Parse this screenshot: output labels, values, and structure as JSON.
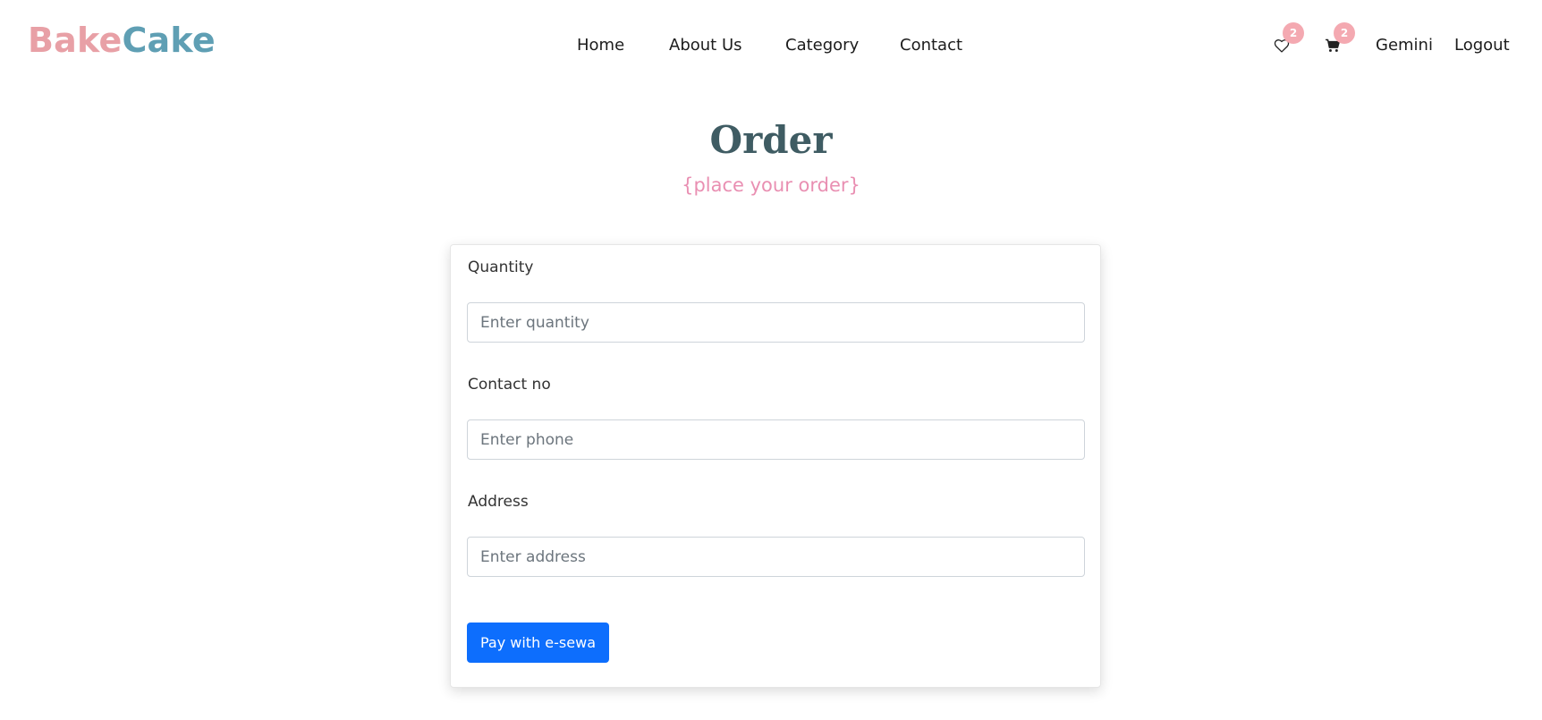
{
  "brand": {
    "part1": "Bake",
    "part2": "Cake"
  },
  "nav": {
    "links": [
      "Home",
      "About Us",
      "Category",
      "Contact"
    ],
    "wishlist_count": "2",
    "cart_count": "2",
    "user": "Gemini",
    "logout": "Logout"
  },
  "page": {
    "title": "Order",
    "subtitle": "{place your order}"
  },
  "form": {
    "quantity_label": "Quantity",
    "quantity_placeholder": "Enter quantity",
    "contact_label": "Contact no",
    "contact_placeholder": "Enter phone",
    "address_label": "Address",
    "address_placeholder": "Enter address",
    "submit_label": "Pay with e-sewa"
  },
  "colors": {
    "brand_bake": "#e8a0a6",
    "brand_cake": "#5f9fb4",
    "title": "#3f5c63",
    "subtitle": "#e98fb2",
    "badge": "#f4a9b1",
    "primary_button": "#0d6efd"
  },
  "icons": {
    "wishlist": "heart-icon",
    "cart": "cart-icon"
  }
}
